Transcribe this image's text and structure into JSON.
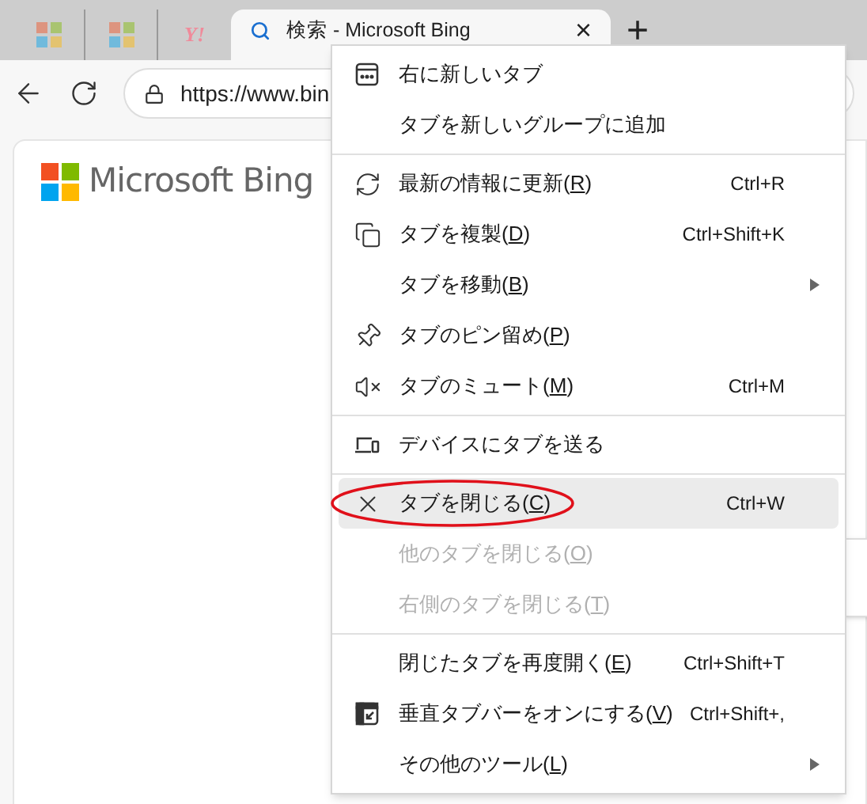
{
  "tabs": [
    {
      "kind": "logo",
      "selected": false
    },
    {
      "kind": "logo",
      "selected": false
    },
    {
      "kind": "text-logo",
      "label": "Y!",
      "selected": false
    },
    {
      "kind": "search",
      "title": "検索 - Microsoft Bing",
      "selected": true,
      "close": "×"
    }
  ],
  "new_tab": "+",
  "address_bar": {
    "url": "https://www.bin"
  },
  "page": {
    "logo_text": "Microsoft Bing"
  },
  "menu": [
    {
      "kind": "item",
      "label": "右に新しいタブ",
      "disabled": false,
      "selected": false
    },
    {
      "kind": "item",
      "label": "タブを新しいグループに追加",
      "disabled": false,
      "selected": false
    },
    {
      "kind": "separator"
    },
    {
      "kind": "item",
      "label": "最新の情報に更新(R)",
      "access_key": true,
      "shortcut": "Ctrl+R",
      "disabled": false,
      "selected": false
    },
    {
      "kind": "item",
      "label": "タブを複製(D)",
      "access_key": true,
      "shortcut": "Ctrl+Shift+K",
      "disabled": false,
      "selected": false
    },
    {
      "kind": "item",
      "label": "タブを移動(B)",
      "access_key": true,
      "submenu": true,
      "disabled": false,
      "selected": false
    },
    {
      "kind": "item",
      "label": "タブのピン留め(P)",
      "access_key": true,
      "disabled": false,
      "selected": false
    },
    {
      "kind": "item",
      "label": "タブのミュート(M)",
      "access_key": true,
      "shortcut": "Ctrl+M",
      "disabled": false,
      "selected": false
    },
    {
      "kind": "separator"
    },
    {
      "kind": "item",
      "label": "デバイスにタブを送る",
      "disabled": false,
      "selected": false
    },
    {
      "kind": "separator"
    },
    {
      "kind": "item",
      "label": "タブを閉じる(C)",
      "access_key": true,
      "shortcut": "Ctrl+W",
      "disabled": false,
      "selected": true,
      "circled": true
    },
    {
      "kind": "item",
      "label": "他のタブを閉じる(O)",
      "access_key": true,
      "disabled": true,
      "selected": false
    },
    {
      "kind": "item",
      "label": "右側のタブを閉じる(T)",
      "access_key": true,
      "disabled": true,
      "selected": false
    },
    {
      "kind": "separator"
    },
    {
      "kind": "item",
      "label": "閉じたタブを再度開く(E)",
      "access_key": true,
      "shortcut": "Ctrl+Shift+T",
      "disabled": false,
      "selected": false
    },
    {
      "kind": "item",
      "label": "垂直タブバーをオンにする(V)",
      "access_key": true,
      "shortcut": "Ctrl+Shift+,",
      "disabled": false,
      "selected": false
    },
    {
      "kind": "item",
      "label": "その他のツール(L)",
      "access_key": true,
      "submenu": true,
      "disabled": false,
      "selected": false
    }
  ]
}
